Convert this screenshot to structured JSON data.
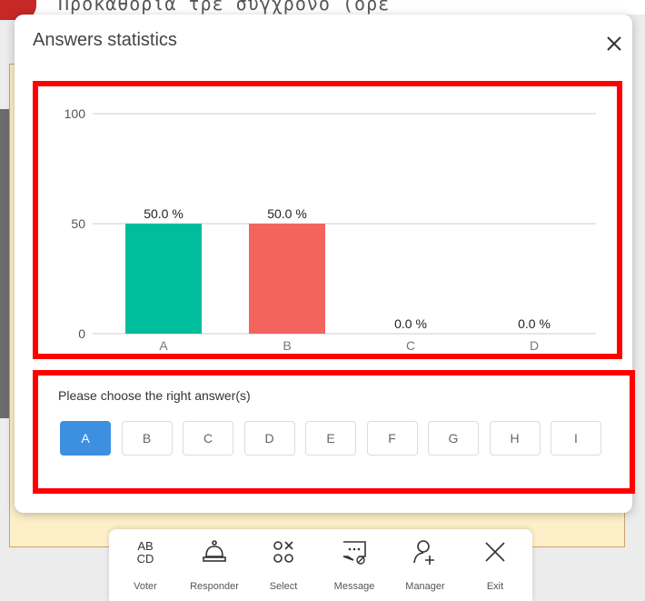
{
  "background": {
    "top_text": "Προκαθορια τρε συγχρονο (ορε"
  },
  "dialog": {
    "title": "Answers statistics"
  },
  "chart_data": {
    "type": "bar",
    "categories": [
      "A",
      "B",
      "C",
      "D"
    ],
    "values": [
      50.0,
      50.0,
      0.0,
      0.0
    ],
    "value_labels": [
      "50.0 %",
      "50.0 %",
      "0.0 %",
      "0.0 %"
    ],
    "colors": [
      "#00bd9c",
      "#f4645f",
      "#cccccc",
      "#cccccc"
    ],
    "yticks": [
      0,
      50,
      100
    ],
    "ylim": [
      0,
      100
    ],
    "grid": true,
    "title": "",
    "xlabel": "",
    "ylabel": ""
  },
  "answers": {
    "prompt": "Please choose the right answer(s)",
    "options": [
      "A",
      "B",
      "C",
      "D",
      "E",
      "F",
      "G",
      "H",
      "I"
    ],
    "selected": "A",
    "selected_color": "#3d8fe0"
  },
  "toolbar": {
    "items": [
      {
        "label": "Voter",
        "icon": "voter-icon"
      },
      {
        "label": "Responder",
        "icon": "bell-icon"
      },
      {
        "label": "Select",
        "icon": "select-icon"
      },
      {
        "label": "Message",
        "icon": "message-icon"
      },
      {
        "label": "Manager",
        "icon": "add-user-icon"
      },
      {
        "label": "Exit",
        "icon": "exit-icon"
      }
    ]
  }
}
